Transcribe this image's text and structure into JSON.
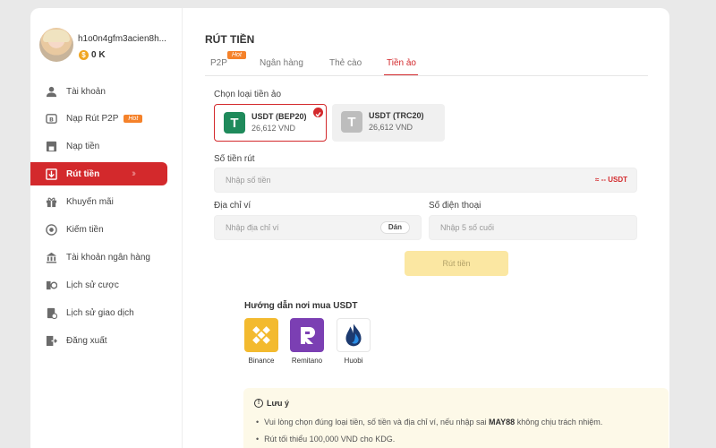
{
  "user": {
    "name": "h1o0n4gfm3acien8h...",
    "balance": "0 K",
    "coin_symbol": "$"
  },
  "sidebar": {
    "items": [
      {
        "label": "Tài khoản",
        "icon": "user-icon"
      },
      {
        "label": "Nạp Rút P2P",
        "icon": "p2p-icon",
        "badge": "Hot"
      },
      {
        "label": "Nạp tiền",
        "icon": "deposit-icon"
      },
      {
        "label": "Rút tiền",
        "icon": "withdraw-icon",
        "active": true
      },
      {
        "label": "Khuyến mãi",
        "icon": "gift-icon"
      },
      {
        "label": "Kiếm tiền",
        "icon": "earn-icon"
      },
      {
        "label": "Tài khoản ngân hàng",
        "icon": "bank-icon"
      },
      {
        "label": "Lịch sử cược",
        "icon": "bet-history-icon"
      },
      {
        "label": "Lịch sử giao dịch",
        "icon": "transaction-history-icon"
      },
      {
        "label": "Đăng xuất",
        "icon": "logout-icon"
      }
    ]
  },
  "page": {
    "title": "RÚT TIỀN"
  },
  "tabs": [
    {
      "label": "P2P",
      "badge": "Hot"
    },
    {
      "label": "Ngân hàng"
    },
    {
      "label": "Thẻ cào"
    },
    {
      "label": "Tiền ảo",
      "active": true
    }
  ],
  "form": {
    "coin_type_label": "Chọn loại tiền ảo",
    "coins": [
      {
        "name": "USDT (BEP20)",
        "rate": "26,612 VND",
        "selected": true,
        "color": "#1f8a5b"
      },
      {
        "name": "USDT (TRC20)",
        "rate": "26,612 VND",
        "selected": false,
        "color": "#bdbdbd"
      }
    ],
    "amount_label": "Số tiền rút",
    "amount_placeholder": "Nhập số tiền",
    "amount_conversion": "≈ -- USDT",
    "wallet_label": "Địa chỉ ví",
    "wallet_placeholder": "Nhập địa chỉ ví",
    "paste_label": "Dán",
    "phone_label": "Số điện thoại",
    "phone_placeholder": "Nhập 5 số cuối",
    "submit_label": "Rút tiền"
  },
  "guide": {
    "title": "Hướng dẫn nơi mua USDT",
    "exchanges": [
      {
        "name": "Binance",
        "icon": "binance-icon",
        "color": "#f3ba2f"
      },
      {
        "name": "Remitano",
        "icon": "remitano-icon",
        "color": "#7b3fb3"
      },
      {
        "name": "Huobi",
        "icon": "huobi-icon",
        "color": "#1c3a70"
      }
    ]
  },
  "note": {
    "title": "Lưu ý",
    "line1_prefix": "Vui lòng chọn đúng loại tiền, số tiền và địa chỉ ví, nếu nhập sai ",
    "line1_brand": "MAY88",
    "line1_suffix": " không chịu trách nhiệm.",
    "line2": "Rút tối thiểu 100,000 VND cho KDG."
  },
  "colors": {
    "accent": "#d3292c",
    "hot": "#f5822a",
    "submit_bg": "#fbe7a2"
  }
}
